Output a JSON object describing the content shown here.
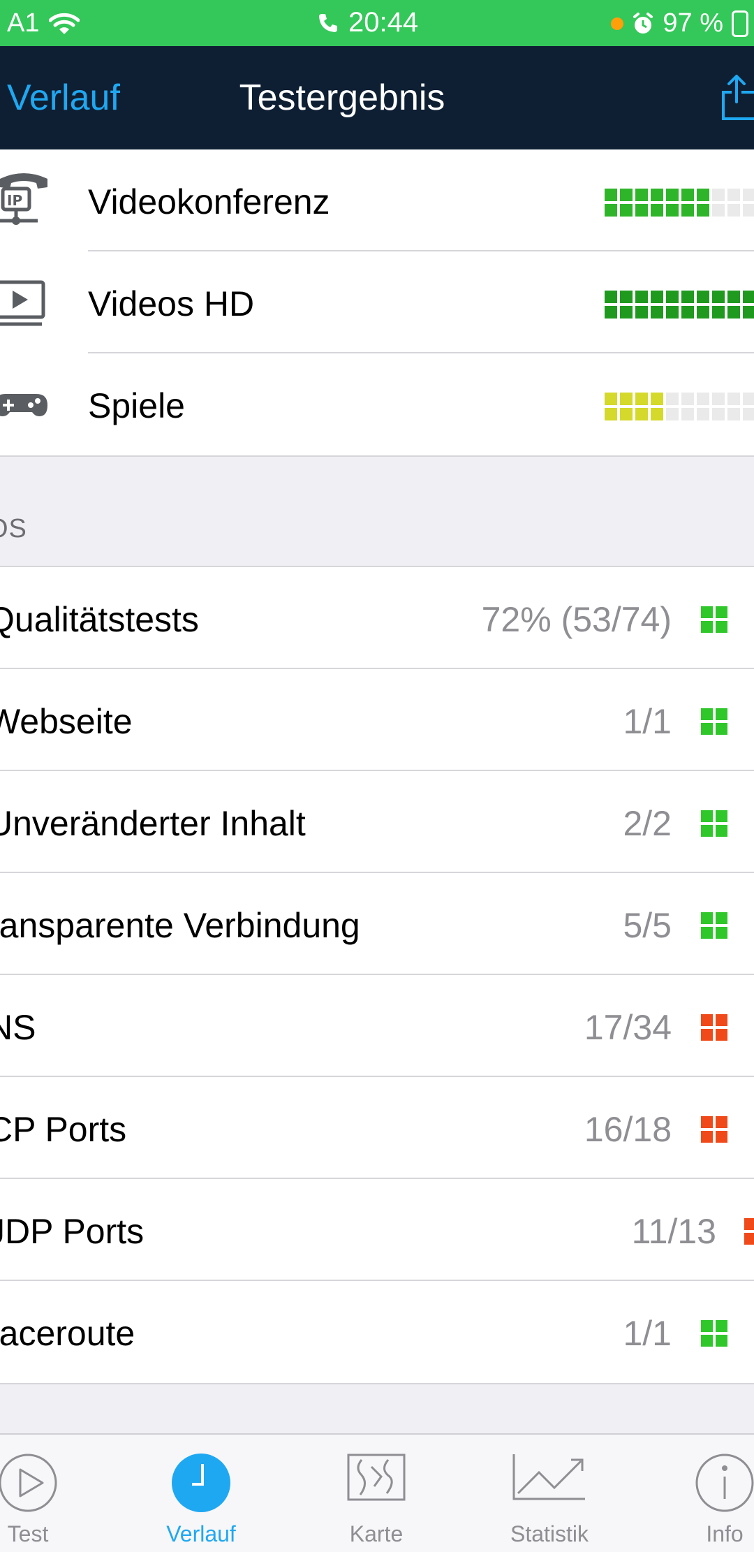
{
  "status_bar": {
    "carrier": "A1",
    "time": "20:44",
    "battery": "97 %",
    "colors": {
      "background": "#34c759",
      "dot": "#ff9f0a"
    }
  },
  "nav": {
    "back_label": "Verlauf",
    "title": "Testergebnis",
    "colors": {
      "background": "#0e1f33",
      "accent": "#1fa8f2"
    }
  },
  "usage_ratings": [
    {
      "icon": "voip-phone-icon",
      "label": "Videokonferenz",
      "level_of_10": 7,
      "color": "#2fb52a"
    },
    {
      "icon": "video-screen-icon",
      "label": "Videos HD",
      "level_of_10": 10,
      "color": "#1f9a1f"
    },
    {
      "icon": "gamepad-icon",
      "label": "Spiele",
      "level_of_10": 4,
      "color": "#d4d92b"
    }
  ],
  "qos": {
    "section_header": "OS",
    "items": [
      {
        "label": "Qualitätstests",
        "value": "72% (53/74)",
        "status": "good"
      },
      {
        "label": "Webseite",
        "value": "1/1",
        "status": "good"
      },
      {
        "label": "Unveränderter Inhalt",
        "value": "2/2",
        "status": "good"
      },
      {
        "label": "ransparente Verbindung",
        "value": "5/5",
        "status": "good"
      },
      {
        "label": "NS",
        "value": "17/34",
        "status": "bad"
      },
      {
        "label": "CP Ports",
        "value": "16/18",
        "status": "bad"
      },
      {
        "label": "JDP Ports",
        "value": "11/13",
        "status": "bad"
      },
      {
        "label": "raceroute",
        "value": "1/1",
        "status": "good"
      }
    ],
    "status_colors": {
      "good": "#2fc72a",
      "bad": "#f04a1a"
    }
  },
  "tabs": [
    {
      "label": "Test",
      "icon": "play-circle-icon",
      "active": false
    },
    {
      "label": "Verlauf",
      "icon": "clock-icon",
      "active": true
    },
    {
      "label": "Karte",
      "icon": "map-icon",
      "active": false
    },
    {
      "label": "Statistik",
      "icon": "chart-icon",
      "active": false
    },
    {
      "label": "Info",
      "icon": "info-icon",
      "active": false
    }
  ]
}
